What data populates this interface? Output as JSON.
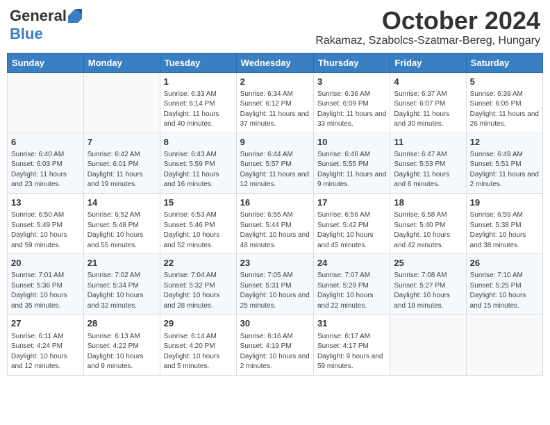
{
  "header": {
    "logo_general": "General",
    "logo_blue": "Blue",
    "title": "October 2024",
    "subtitle": "Rakamaz, Szabolcs-Szatmar-Bereg, Hungary"
  },
  "weekdays": [
    "Sunday",
    "Monday",
    "Tuesday",
    "Wednesday",
    "Thursday",
    "Friday",
    "Saturday"
  ],
  "weeks": [
    [
      {
        "day": "",
        "info": ""
      },
      {
        "day": "",
        "info": ""
      },
      {
        "day": "1",
        "info": "Sunrise: 6:33 AM\nSunset: 6:14 PM\nDaylight: 11 hours and 40 minutes."
      },
      {
        "day": "2",
        "info": "Sunrise: 6:34 AM\nSunset: 6:12 PM\nDaylight: 11 hours and 37 minutes."
      },
      {
        "day": "3",
        "info": "Sunrise: 6:36 AM\nSunset: 6:09 PM\nDaylight: 11 hours and 33 minutes."
      },
      {
        "day": "4",
        "info": "Sunrise: 6:37 AM\nSunset: 6:07 PM\nDaylight: 11 hours and 30 minutes."
      },
      {
        "day": "5",
        "info": "Sunrise: 6:39 AM\nSunset: 6:05 PM\nDaylight: 11 hours and 26 minutes."
      }
    ],
    [
      {
        "day": "6",
        "info": "Sunrise: 6:40 AM\nSunset: 6:03 PM\nDaylight: 11 hours and 23 minutes."
      },
      {
        "day": "7",
        "info": "Sunrise: 6:42 AM\nSunset: 6:01 PM\nDaylight: 11 hours and 19 minutes."
      },
      {
        "day": "8",
        "info": "Sunrise: 6:43 AM\nSunset: 5:59 PM\nDaylight: 11 hours and 16 minutes."
      },
      {
        "day": "9",
        "info": "Sunrise: 6:44 AM\nSunset: 5:57 PM\nDaylight: 11 hours and 12 minutes."
      },
      {
        "day": "10",
        "info": "Sunrise: 6:46 AM\nSunset: 5:55 PM\nDaylight: 11 hours and 9 minutes."
      },
      {
        "day": "11",
        "info": "Sunrise: 6:47 AM\nSunset: 5:53 PM\nDaylight: 11 hours and 6 minutes."
      },
      {
        "day": "12",
        "info": "Sunrise: 6:49 AM\nSunset: 5:51 PM\nDaylight: 11 hours and 2 minutes."
      }
    ],
    [
      {
        "day": "13",
        "info": "Sunrise: 6:50 AM\nSunset: 5:49 PM\nDaylight: 10 hours and 59 minutes."
      },
      {
        "day": "14",
        "info": "Sunrise: 6:52 AM\nSunset: 5:48 PM\nDaylight: 10 hours and 55 minutes."
      },
      {
        "day": "15",
        "info": "Sunrise: 6:53 AM\nSunset: 5:46 PM\nDaylight: 10 hours and 52 minutes."
      },
      {
        "day": "16",
        "info": "Sunrise: 6:55 AM\nSunset: 5:44 PM\nDaylight: 10 hours and 48 minutes."
      },
      {
        "day": "17",
        "info": "Sunrise: 6:56 AM\nSunset: 5:42 PM\nDaylight: 10 hours and 45 minutes."
      },
      {
        "day": "18",
        "info": "Sunrise: 6:58 AM\nSunset: 5:40 PM\nDaylight: 10 hours and 42 minutes."
      },
      {
        "day": "19",
        "info": "Sunrise: 6:59 AM\nSunset: 5:38 PM\nDaylight: 10 hours and 38 minutes."
      }
    ],
    [
      {
        "day": "20",
        "info": "Sunrise: 7:01 AM\nSunset: 5:36 PM\nDaylight: 10 hours and 35 minutes."
      },
      {
        "day": "21",
        "info": "Sunrise: 7:02 AM\nSunset: 5:34 PM\nDaylight: 10 hours and 32 minutes."
      },
      {
        "day": "22",
        "info": "Sunrise: 7:04 AM\nSunset: 5:32 PM\nDaylight: 10 hours and 28 minutes."
      },
      {
        "day": "23",
        "info": "Sunrise: 7:05 AM\nSunset: 5:31 PM\nDaylight: 10 hours and 25 minutes."
      },
      {
        "day": "24",
        "info": "Sunrise: 7:07 AM\nSunset: 5:29 PM\nDaylight: 10 hours and 22 minutes."
      },
      {
        "day": "25",
        "info": "Sunrise: 7:08 AM\nSunset: 5:27 PM\nDaylight: 10 hours and 18 minutes."
      },
      {
        "day": "26",
        "info": "Sunrise: 7:10 AM\nSunset: 5:25 PM\nDaylight: 10 hours and 15 minutes."
      }
    ],
    [
      {
        "day": "27",
        "info": "Sunrise: 6:11 AM\nSunset: 4:24 PM\nDaylight: 10 hours and 12 minutes."
      },
      {
        "day": "28",
        "info": "Sunrise: 6:13 AM\nSunset: 4:22 PM\nDaylight: 10 hours and 9 minutes."
      },
      {
        "day": "29",
        "info": "Sunrise: 6:14 AM\nSunset: 4:20 PM\nDaylight: 10 hours and 5 minutes."
      },
      {
        "day": "30",
        "info": "Sunrise: 6:16 AM\nSunset: 4:19 PM\nDaylight: 10 hours and 2 minutes."
      },
      {
        "day": "31",
        "info": "Sunrise: 6:17 AM\nSunset: 4:17 PM\nDaylight: 9 hours and 59 minutes."
      },
      {
        "day": "",
        "info": ""
      },
      {
        "day": "",
        "info": ""
      }
    ]
  ]
}
